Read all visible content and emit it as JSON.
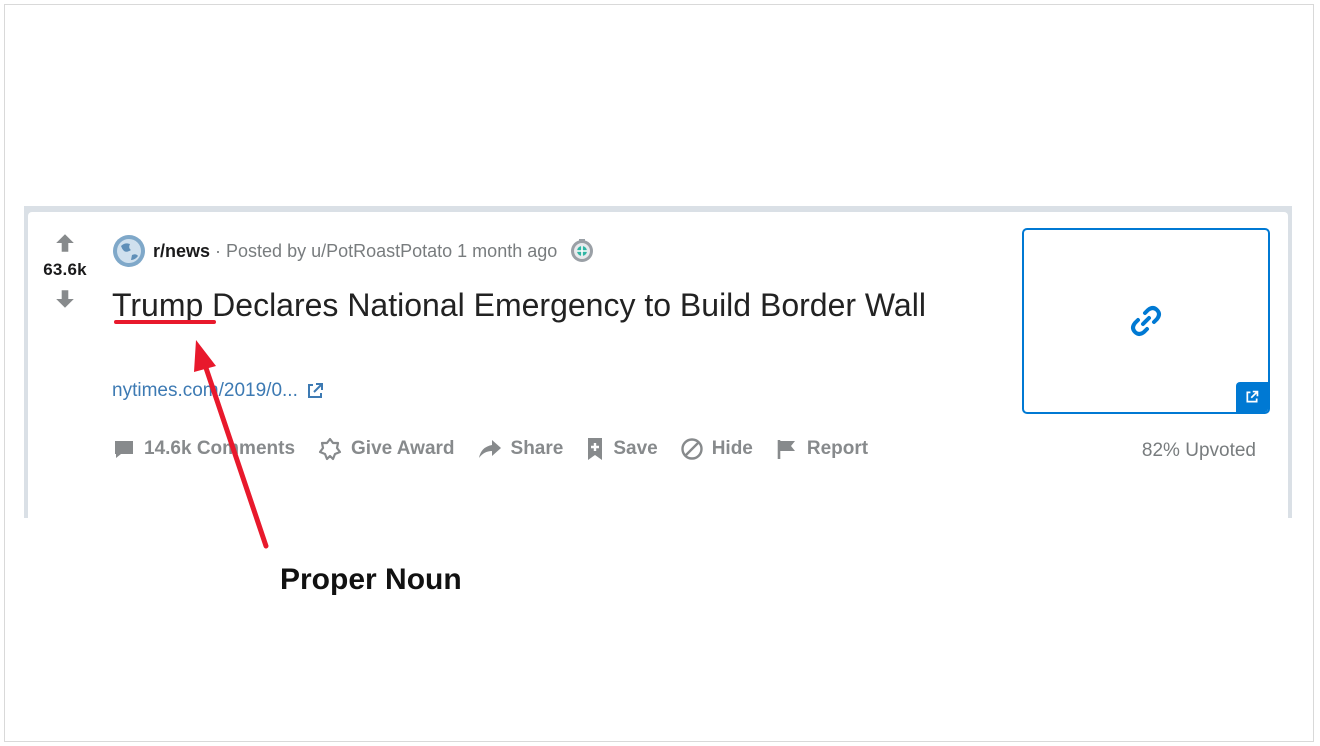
{
  "post": {
    "vote_count": "63.6k",
    "subreddit": "r/news",
    "separator": "·",
    "posted_by": "Posted by u/PotRoastPotato 1 month ago",
    "title": "Trump Declares National Emergency to Build Border Wall",
    "domain": "nytimes.com/2019/0...",
    "actions": {
      "comments": "14.6k Comments",
      "award": "Give Award",
      "share": "Share",
      "save": "Save",
      "hide": "Hide",
      "report": "Report"
    },
    "upvoted": "82% Upvoted"
  },
  "annotation": {
    "label": "Proper Noun",
    "color": "#e8192c"
  },
  "colors": {
    "accent": "#0079d3",
    "link": "#3d7ab3",
    "muted": "#878a8c"
  }
}
